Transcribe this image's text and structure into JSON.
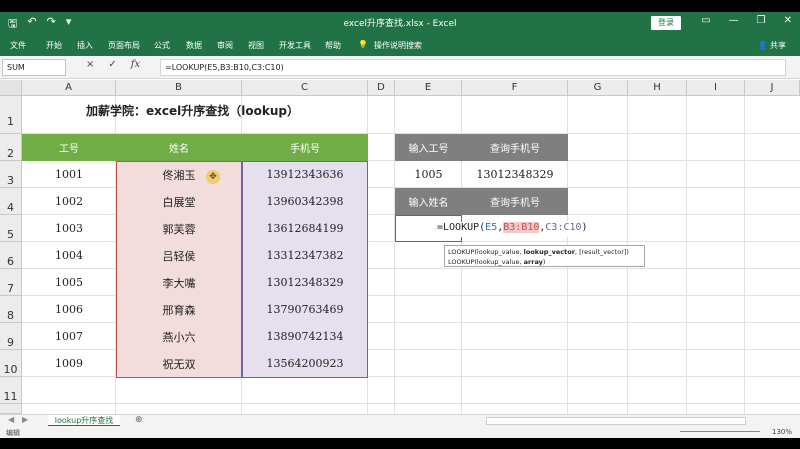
{
  "window": {
    "title": "excel升序查找.xlsx - Excel",
    "login_label": "登录"
  },
  "ribbon": {
    "tabs": [
      "文件",
      "开始",
      "插入",
      "页面布局",
      "公式",
      "数据",
      "审阅",
      "视图",
      "开发工具",
      "帮助"
    ],
    "tell_me": "操作说明搜索",
    "share": "共享"
  },
  "formula_bar": {
    "name_box": "SUM",
    "cancel": "×",
    "enter": "✓",
    "fx": "fx",
    "formula": "=LOOKUP(E5,B3:B10,C3:C10)"
  },
  "columns": [
    "A",
    "B",
    "C",
    "D",
    "E",
    "F",
    "G",
    "H",
    "I",
    "J"
  ],
  "rows": [
    "1",
    "2",
    "3",
    "4",
    "5",
    "6",
    "7",
    "8",
    "9",
    "10",
    "11"
  ],
  "sheet_title": "加薪学院：excel升序查找（lookup）",
  "table": {
    "headers": [
      "工号",
      "姓名",
      "手机号"
    ],
    "rows": [
      [
        "1001",
        "佟湘玉",
        "13912343636"
      ],
      [
        "1002",
        "白展堂",
        "13960342398"
      ],
      [
        "1003",
        "郭芙蓉",
        "13612684199"
      ],
      [
        "1004",
        "吕轻侯",
        "13312347382"
      ],
      [
        "1005",
        "李大嘴",
        "13012348329"
      ],
      [
        "1006",
        "邢育森",
        "13790763469"
      ],
      [
        "1007",
        "燕小六",
        "13890742134"
      ],
      [
        "1009",
        "祝无双",
        "13564200923"
      ]
    ]
  },
  "lookup1": {
    "header_input": "输入工号",
    "header_result": "查询手机号",
    "input": "1005",
    "result": "13012348329"
  },
  "lookup2": {
    "header_input": "输入姓名",
    "header_result": "查询手机号",
    "editing_formula": {
      "prefix": "=LOOKUP(",
      "arg1": "E5",
      "sep1": ",",
      "arg2": "B3:B10",
      "sep2": ",",
      "arg3": "C3:C10",
      "suffix": ")"
    }
  },
  "tooltip": {
    "line1_prefix": "LOOKUP(lookup_value, ",
    "line1_bold": "lookup_vector",
    "line1_suffix": ", [result_vector])",
    "line2_prefix": "LOOKUP(lookup_value, ",
    "line2_bold": "array",
    "line2_suffix": ")"
  },
  "sheet_tab": "lookup升序查找",
  "status": {
    "mode": "编辑",
    "zoom": "130%"
  },
  "colors": {
    "excel_green": "#217346",
    "table_header_green": "#70ad47",
    "lookup_header_gray": "#7f7f7f",
    "name_col_fill": "#f3dcdc",
    "phone_col_fill": "#e6e0ee"
  }
}
